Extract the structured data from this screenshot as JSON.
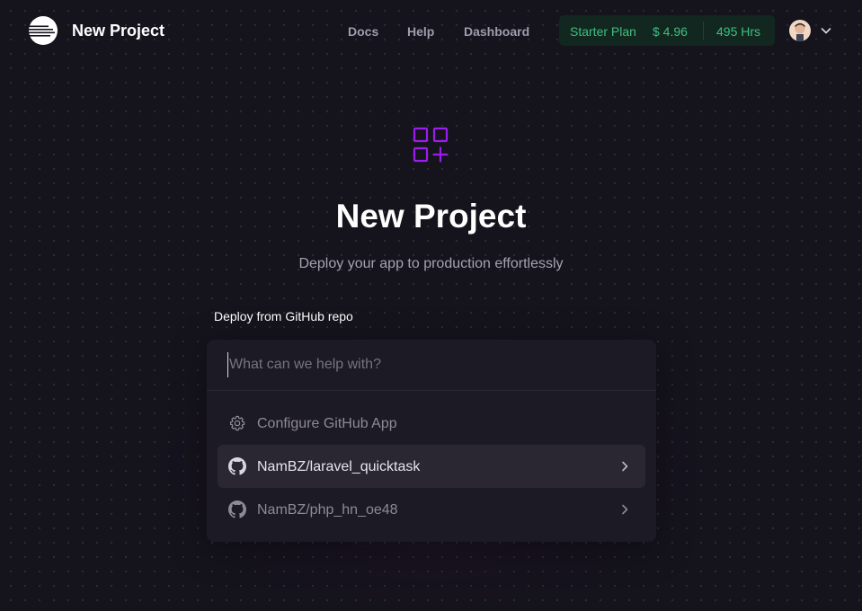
{
  "header": {
    "title": "New Project",
    "nav": {
      "docs": "Docs",
      "help": "Help",
      "dashboard": "Dashboard"
    },
    "plan": {
      "name": "Starter Plan",
      "cost": "$ 4.96",
      "hours": "495 Hrs"
    }
  },
  "hero": {
    "title": "New Project",
    "subtitle": "Deploy your app to production effortlessly"
  },
  "section_label": "Deploy from GitHub repo",
  "search": {
    "value": "",
    "placeholder": "What can we help with?"
  },
  "options": [
    {
      "label": "Configure GitHub App",
      "icon": "gear-icon"
    },
    {
      "label": "NamBZ/laravel_quicktask",
      "icon": "github-icon"
    },
    {
      "label": "NamBZ/php_hn_oe48",
      "icon": "github-icon"
    }
  ],
  "colors": {
    "background": "#15131c",
    "accent_purple": "#9b1dea",
    "plan_green": "#3fbf7f",
    "panel": "#1c1a24"
  }
}
